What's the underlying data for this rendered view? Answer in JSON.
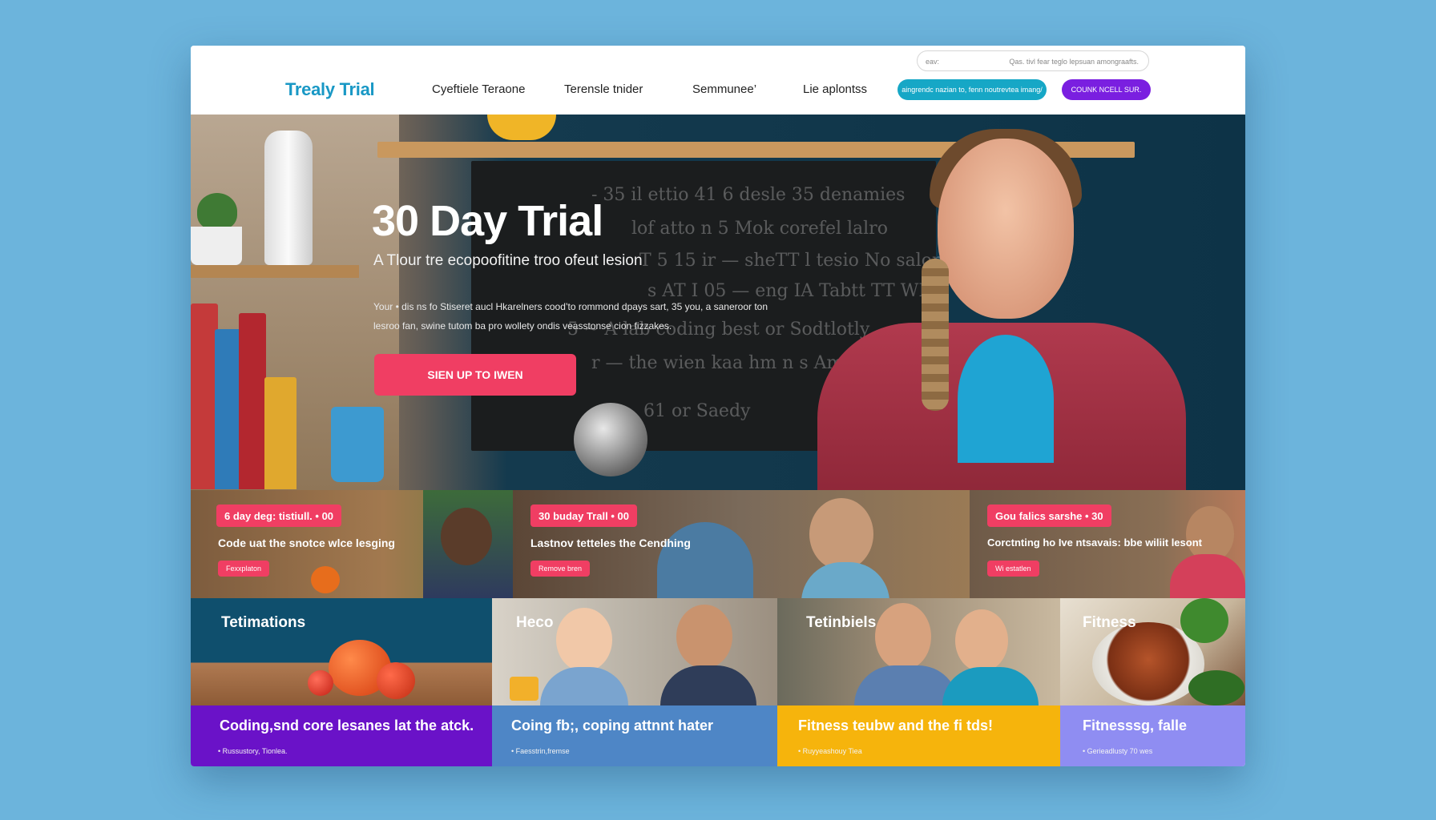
{
  "header": {
    "logo": "Trealy Trial",
    "nav": [
      "Cyeftiele Teraone",
      "Terensle tnider",
      "Semmunee’",
      "Lie aplontss"
    ],
    "search_left": "eav:",
    "search_right": "Qas. tivl fear teglo lepsuan amongraafts.",
    "pill_teal": "aingrendc nazian to, fenn noutrevtea imang/",
    "pill_purple": "COUNK NCELL SUR."
  },
  "hero": {
    "title": "30 Day Trial",
    "subtitle": "A Tlour tre ecopoofitine troo ofeut lesion",
    "body_line1": "Your • dis ns fo Stiseret aucl Hkarelners cood’to rommond dpays sart, 35 you, a saneroor ton",
    "body_line2": "lesroo fan, swine tutom ba pro wollety ondis veasstonse cion fizzakes.",
    "cta": "SIEN UP TO IWEN",
    "chalk": [
      "- 35 il ettio 41 6 desle 35 denamies",
      "lof atto n 5 Mok corefel lalro",
      "T 5 15 ir — sheTT l tesio No salonts,",
      "s AT I 05 — eng IA Tabtt TT WH",
      "5 ~ A lab coding best or Sodtlotly",
      "r — the wien kaa hm n s Amlt the",
      "61 or Saedy"
    ]
  },
  "promos": [
    {
      "badge": "6 day deg: tistiull.  • 00",
      "text": "Code uat the snotce wlce lesging",
      "chip": "Fexxplaton"
    },
    {
      "badge": "30 buday Trall  • 00",
      "text": "Lastnov tetteles the Cendhing",
      "chip": "Remove bren"
    },
    {
      "badge": "Gou falics sarshe  • 30",
      "text": "Corctnting ho Ive ntsavais: bbe wiliit lesont",
      "chip": "Wi estatlen"
    }
  ],
  "tiles": [
    {
      "title": "Tetimations",
      "head": "Coding,snd core lesanes lat the atck.",
      "meta": "• Russustory, Tionlea.",
      "color": "#6a12c8"
    },
    {
      "title": "Heco",
      "head": "Coing fb;, coping attnnt hater",
      "meta": "• Faesstrin,fremse",
      "color": "#4e86c6"
    },
    {
      "title": "Tetinbiels",
      "head": "Fitness teubw and the fi tds!",
      "meta": "• Ruyyeashouy Tiea",
      "color": "#f6b40c"
    },
    {
      "title": "Fitness",
      "head": "Fitnesssg, falle",
      "meta": "• Gerieadlusty 70 wes",
      "color": "#8f8df2"
    }
  ]
}
